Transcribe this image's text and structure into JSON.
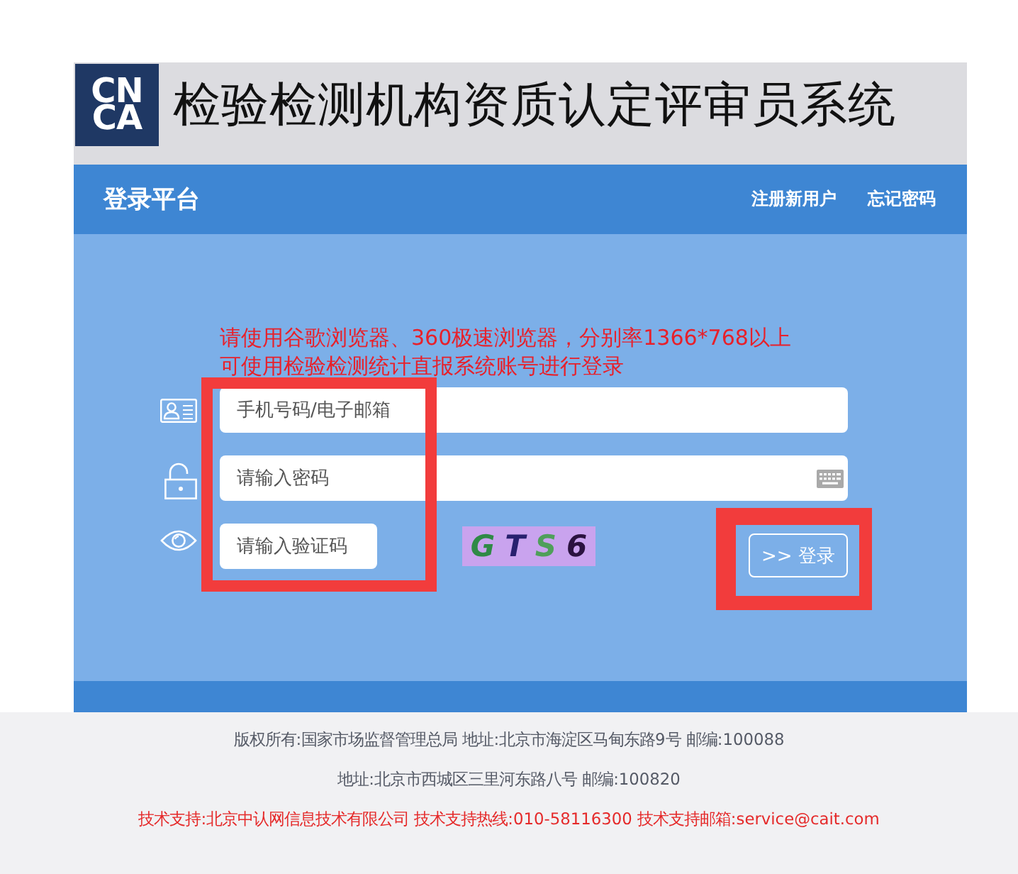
{
  "header": {
    "logo": {
      "top": "CN",
      "bottom": "CA"
    },
    "title": "检验检测机构资质认定评审员系统"
  },
  "nav_bar": {
    "title": "登录平台",
    "links": [
      "注册新用户",
      "忘记密码"
    ]
  },
  "notice": [
    "请使用谷歌浏览器、360极速浏览器，分别率1366*768以上",
    "可使用检验检测统计直报系统账号进行登录"
  ],
  "form": {
    "fields": [
      {
        "kind": "account",
        "placeholder": "手机号码/电子邮箱"
      },
      {
        "kind": "password",
        "placeholder": "请输入密码"
      },
      {
        "kind": "captcha",
        "placeholder": "请输入验证码"
      }
    ],
    "captcha": {
      "chars": [
        {
          "char": "G",
          "color": "#2f8a46"
        },
        {
          "char": "T",
          "color": "#28206e"
        },
        {
          "char": "S",
          "color": "#4f9f5a"
        },
        {
          "char": "6",
          "color": "#2b1240"
        }
      ]
    },
    "submit": ">> 登录"
  },
  "footer": {
    "lines": [
      {
        "kind": "info",
        "text": "版权所有:国家市场监督管理总局 地址:北京市海淀区马甸东路9号 邮编:100088"
      },
      {
        "kind": "info",
        "text": "地址:北京市西城区三里河东路八号 邮编:100820"
      },
      {
        "kind": "support",
        "text": "技术支持:北京中认网信息技术有限公司 技术支持热线:010-58116300 技术支持邮箱:service@cait.com"
      }
    ]
  }
}
